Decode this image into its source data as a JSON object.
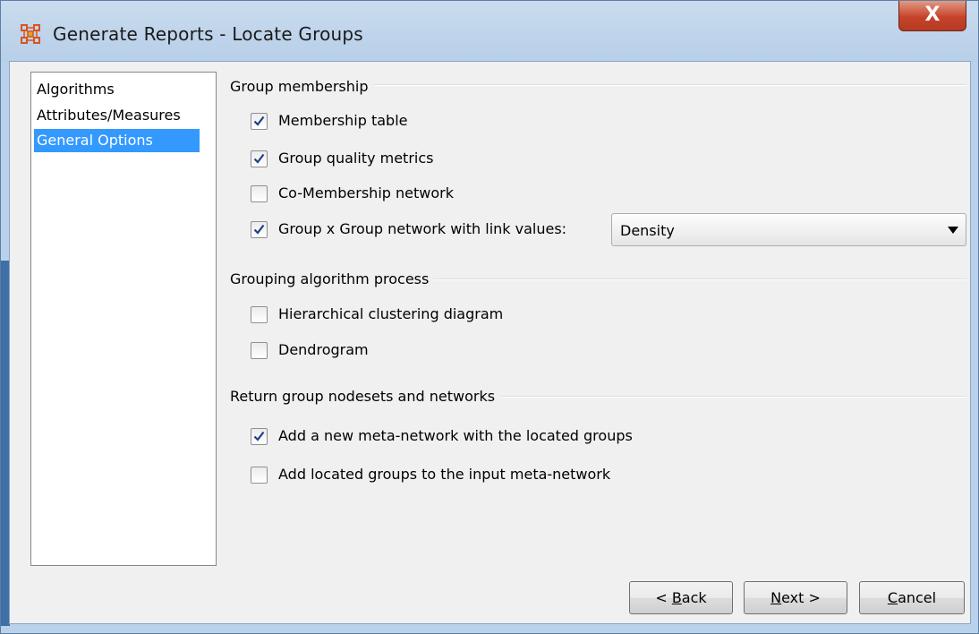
{
  "window": {
    "title": "Generate Reports - Locate Groups",
    "icon": "app-network-icon",
    "close_label": "X"
  },
  "nav": {
    "items": [
      {
        "label": "Algorithms",
        "selected": false
      },
      {
        "label": "Attributes/Measures",
        "selected": false
      },
      {
        "label": "General Options",
        "selected": true
      }
    ]
  },
  "groups": {
    "membership": {
      "title": "Group membership",
      "options": [
        {
          "label": "Membership table",
          "checked": true
        },
        {
          "label": "Group quality metrics",
          "checked": true
        },
        {
          "label": "Co-Membership network",
          "checked": false
        },
        {
          "label": "Group x Group network with link values:",
          "checked": true
        }
      ],
      "link_values_select": "Density"
    },
    "process": {
      "title": "Grouping algorithm process",
      "options": [
        {
          "label": "Hierarchical clustering diagram",
          "checked": false
        },
        {
          "label": "Dendrogram",
          "checked": false
        }
      ]
    },
    "return": {
      "title": "Return group nodesets and networks",
      "options": [
        {
          "label": "Add a new meta-network with the located groups",
          "checked": true
        },
        {
          "label": "Add located groups to the input meta-network",
          "checked": false
        }
      ]
    }
  },
  "buttons": {
    "back": {
      "prefix": "< ",
      "mnemonic": "B",
      "rest": "ack"
    },
    "next": {
      "prefix": "",
      "mnemonic": "N",
      "rest": "ext >"
    },
    "cancel": {
      "prefix": "",
      "mnemonic": "C",
      "rest": "ancel"
    }
  },
  "colors": {
    "selection": "#3399ff",
    "close_button": "#c7432b",
    "window_frame": "#b9d1ea",
    "checkmark": "#1e3f8a"
  }
}
